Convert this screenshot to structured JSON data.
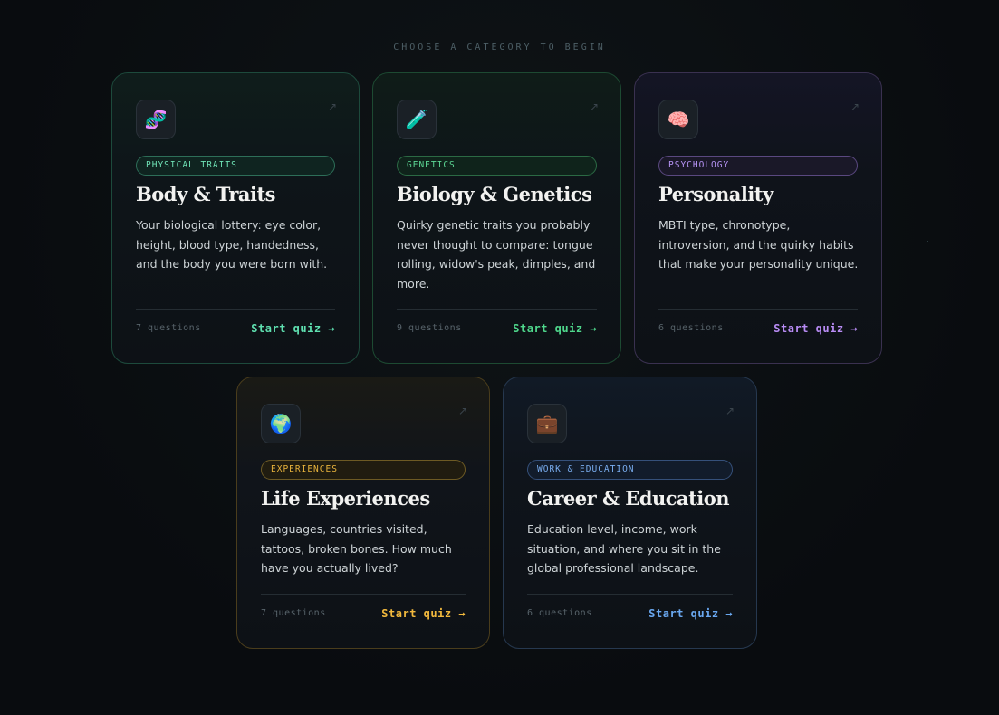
{
  "heading": "CHOOSE A CATEGORY TO BEGIN",
  "cards": [
    {
      "icon": "dna-icon",
      "icon_glyph": "🧬",
      "tag": "PHYSICAL TRAITS",
      "title": "Body & Traits",
      "description": "Your biological lottery: eye color, height, blood type, handedness, and the body you were born with.",
      "count": "7 questions",
      "cta": "Start quiz →",
      "arrow": "↗",
      "accent": "#5fe0b0"
    },
    {
      "icon": "test-tube-icon",
      "icon_glyph": "🧪",
      "tag": "GENETICS",
      "title": "Biology & Genetics",
      "description": "Quirky genetic traits you probably never thought to compare: tongue rolling, widow's peak, dimples, and more.",
      "count": "9 questions",
      "cta": "Start quiz →",
      "arrow": "↗",
      "accent": "#4fd88c"
    },
    {
      "icon": "brain-icon",
      "icon_glyph": "🧠",
      "tag": "PSYCHOLOGY",
      "title": "Personality",
      "description": "MBTI type, chronotype, introversion, and the quirky habits that make your personality unique.",
      "count": "6 questions",
      "cta": "Start quiz →",
      "arrow": "↗",
      "accent": "#b98cf5"
    },
    {
      "icon": "globe-icon",
      "icon_glyph": "🌍",
      "tag": "EXPERIENCES",
      "title": "Life Experiences",
      "description": "Languages, countries visited, tattoos, broken bones. How much have you actually lived?",
      "count": "7 questions",
      "cta": "Start quiz →",
      "arrow": "↗",
      "accent": "#f2b93d"
    },
    {
      "icon": "briefcase-icon",
      "icon_glyph": "💼",
      "tag": "WORK & EDUCATION",
      "title": "Career & Education",
      "description": "Education level, income, work situation, and where you sit in the global professional landscape.",
      "count": "6 questions",
      "cta": "Start quiz →",
      "arrow": "↗",
      "accent": "#6aa8f0"
    }
  ]
}
